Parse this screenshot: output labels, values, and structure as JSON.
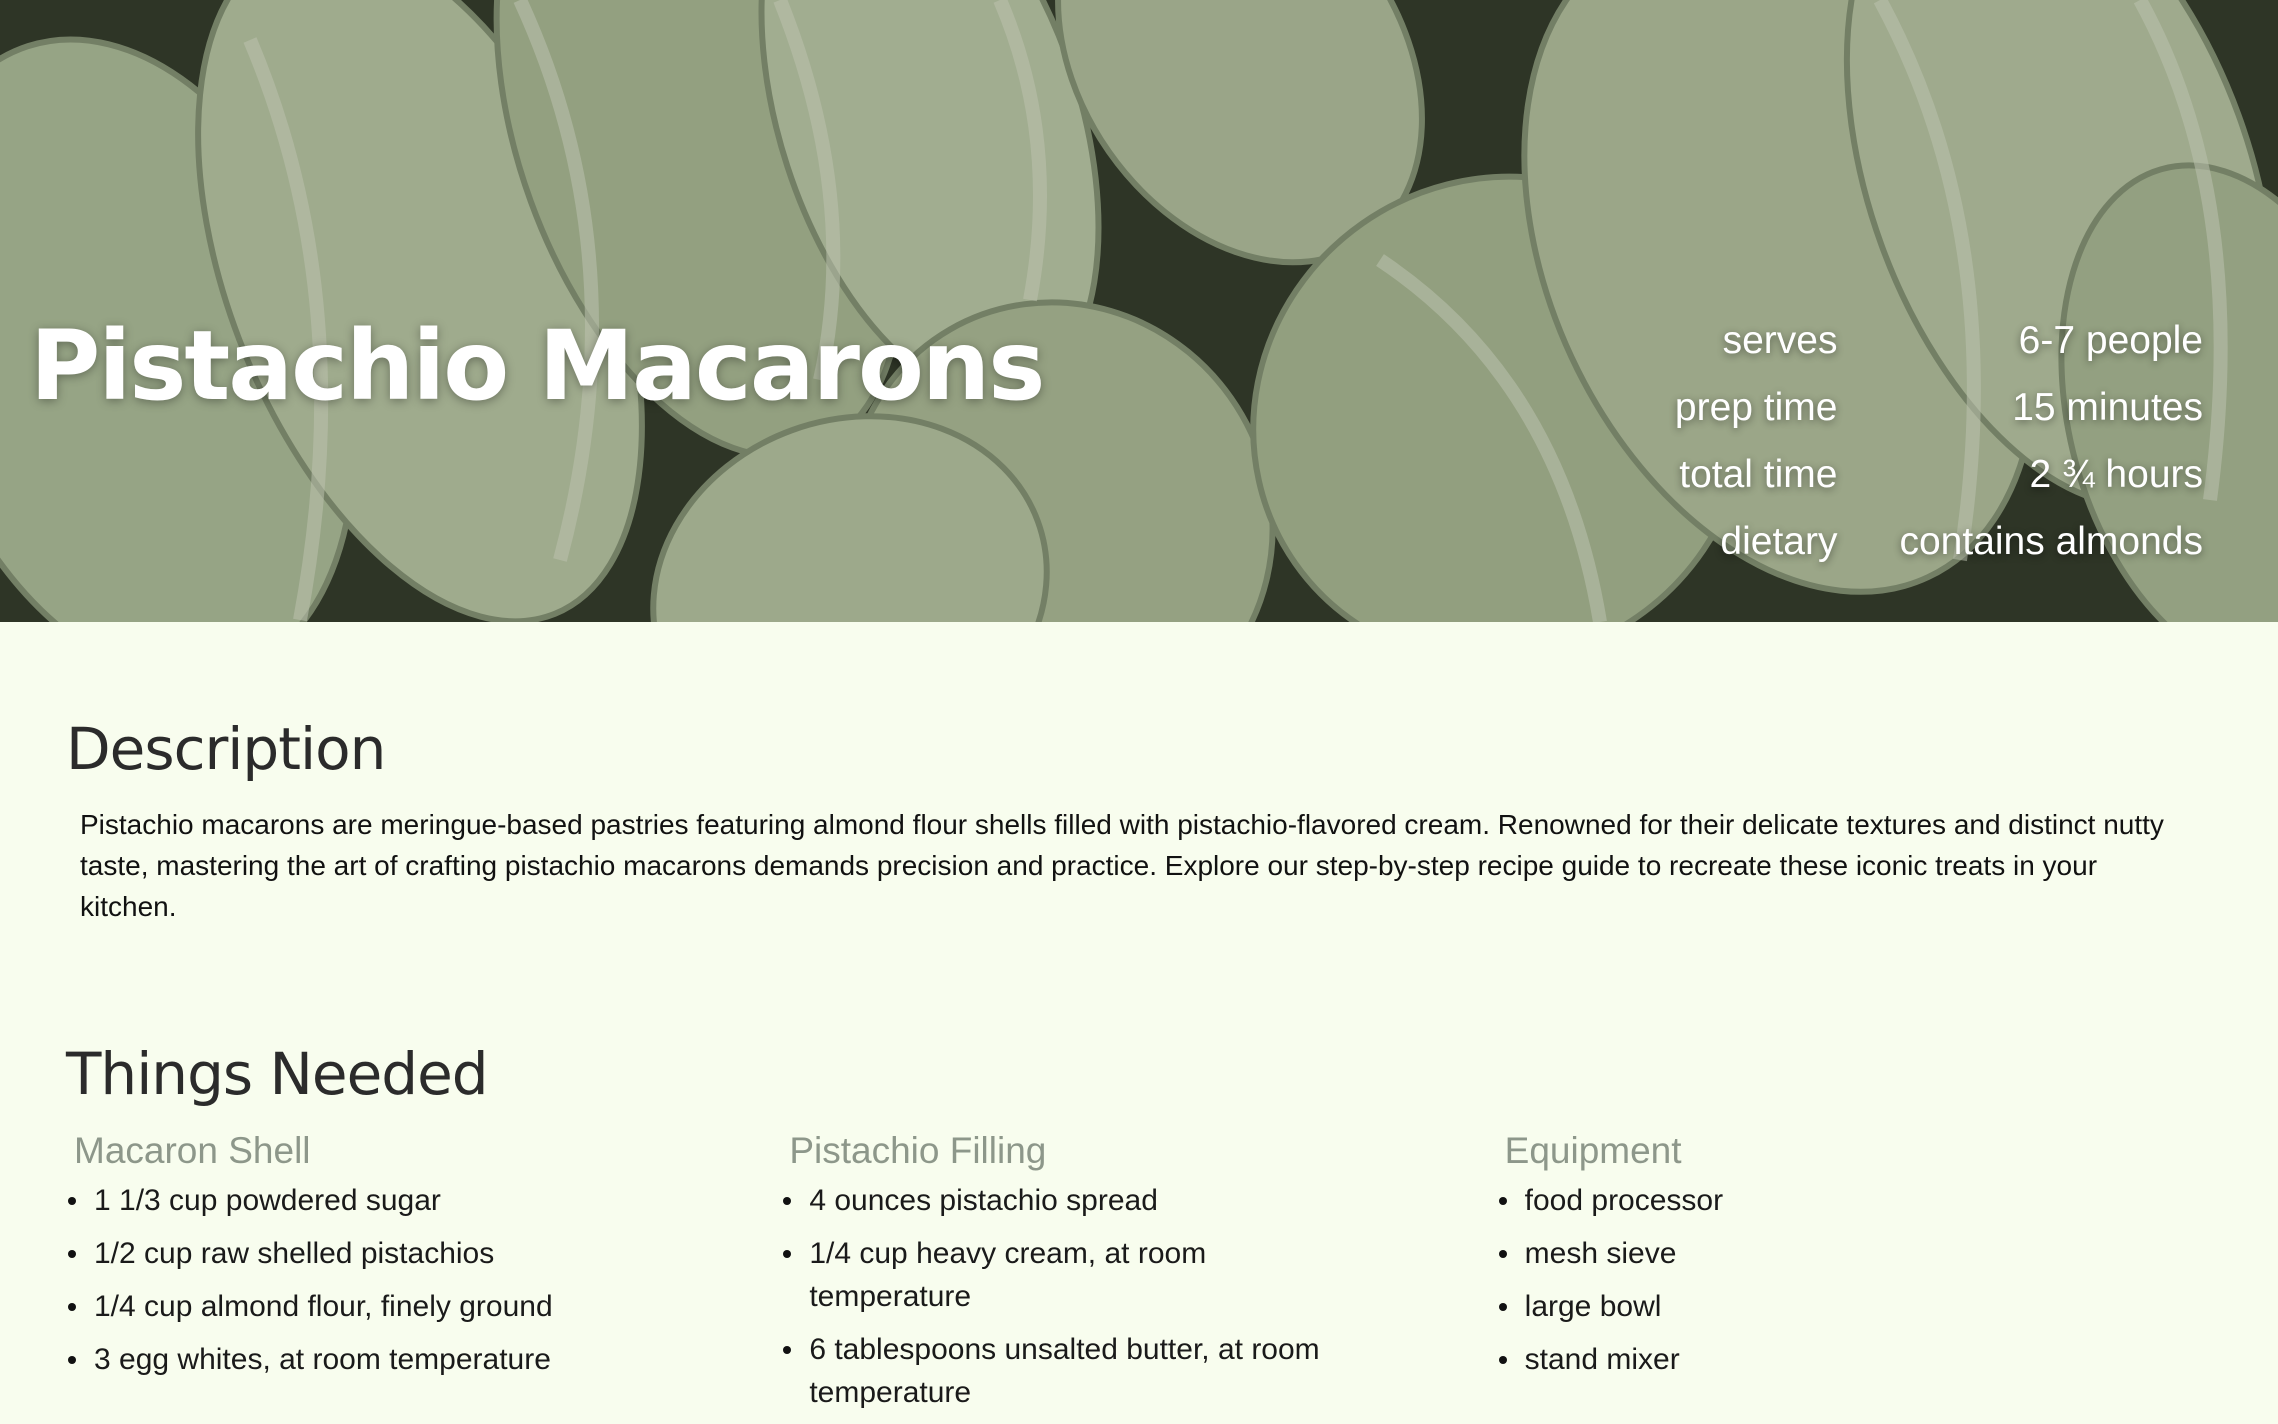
{
  "hero": {
    "title": "Pistachio Macarons",
    "meta": [
      {
        "label": "serves",
        "value": "6-7 people"
      },
      {
        "label": "prep time",
        "value": "15 minutes"
      },
      {
        "label": "total time",
        "value": "2 ¾ hours"
      },
      {
        "label": "dietary",
        "value": "contains almonds"
      }
    ]
  },
  "description": {
    "heading": "Description",
    "text": "Pistachio macarons are meringue-based pastries featuring almond flour shells filled with pistachio-flavored cream. Renowned for their delicate textures and distinct nutty taste, mastering the art of crafting pistachio macarons demands precision and practice. Explore our step-by-step recipe guide to recreate these iconic treats in your kitchen."
  },
  "things_needed": {
    "heading": "Things Needed",
    "columns": [
      {
        "title": "Macaron Shell",
        "items": [
          "1 1/3 cup powdered sugar",
          "1/2 cup raw shelled pistachios",
          "1/4 cup almond flour, finely ground",
          "3 egg whites, at room temperature"
        ]
      },
      {
        "title": "Pistachio Filling",
        "items": [
          "4 ounces pistachio spread",
          "1/4 cup heavy cream, at room temperature",
          "6 tablespoons unsalted butter, at room temperature"
        ]
      },
      {
        "title": "Equipment",
        "items": [
          "food processor",
          "mesh sieve",
          "large bowl",
          "stand mixer"
        ]
      }
    ]
  }
}
